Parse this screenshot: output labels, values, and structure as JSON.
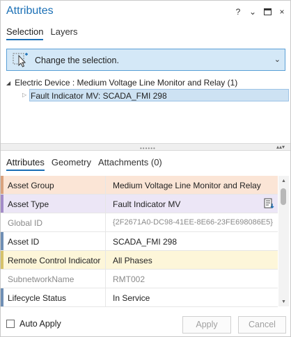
{
  "window": {
    "title": "Attributes",
    "help_glyph": "?",
    "menu_glyph": "⌄",
    "restore_glyph": "▭",
    "close_glyph": "×"
  },
  "top_tabs": [
    {
      "label": "Selection",
      "active": true
    },
    {
      "label": "Layers",
      "active": false
    }
  ],
  "prompt": {
    "text": "Change the selection.",
    "dropdown_glyph": "⌄"
  },
  "tree": {
    "parent_expander": "◢",
    "parent_label": "Electric Device : Medium Voltage Line Monitor and Relay (1)",
    "child_expander": "▷",
    "child_label": "Fault Indicator MV: SCADA_FMI 298"
  },
  "splitter": {
    "dots": "••••••",
    "controls": "▴▴▾"
  },
  "lower_tabs": [
    {
      "label": "Attributes",
      "active": true
    },
    {
      "label": "Geometry",
      "active": false
    },
    {
      "label": "Attachments (0)",
      "active": false
    }
  ],
  "attributes": [
    {
      "name": "Asset Group",
      "value": "Medium Voltage Line Monitor and Relay",
      "bg": "#fbe5d6",
      "marker": "#d9a27e",
      "name_color": "#222222",
      "value_color": "#222222"
    },
    {
      "name": "Asset Type",
      "value": "Fault Indicator MV",
      "bg": "#ece6f6",
      "marker": "#a48cc8",
      "name_color": "#222222",
      "value_color": "#222222",
      "has_icon": true,
      "icon": "list-edit-icon"
    },
    {
      "name": "Global ID",
      "value": "{2F2671A0-DC98-41EE-8E66-23FE698086E5}",
      "bg": "#ffffff",
      "marker": "#ffffff",
      "name_color": "#8a8a8a",
      "value_color": "#8a8a8a"
    },
    {
      "name": "Asset ID",
      "value": "SCADA_FMI 298",
      "bg": "#ffffff",
      "marker": "#6f8fb5",
      "name_color": "#222222",
      "value_color": "#222222"
    },
    {
      "name": "Remote Control Indicator",
      "value": "All Phases",
      "bg": "#fdf6d9",
      "marker": "#d6c26a",
      "name_color": "#222222",
      "value_color": "#222222"
    },
    {
      "name": "SubnetworkName",
      "value": "RMT002",
      "bg": "#ffffff",
      "marker": "#ffffff",
      "name_color": "#8a8a8a",
      "value_color": "#8a8a8a"
    },
    {
      "name": "Lifecycle Status",
      "value": "In Service",
      "bg": "#ffffff",
      "marker": "#6f8fb5",
      "name_color": "#222222",
      "value_color": "#222222"
    }
  ],
  "footer": {
    "auto_apply_label": "Auto Apply",
    "auto_apply_checked": false,
    "apply_label": "Apply",
    "cancel_label": "Cancel"
  },
  "colors": {
    "accent": "#1a6fb5",
    "prompt_bg": "#d4e8f7",
    "selection_bg": "#cde2f3"
  }
}
